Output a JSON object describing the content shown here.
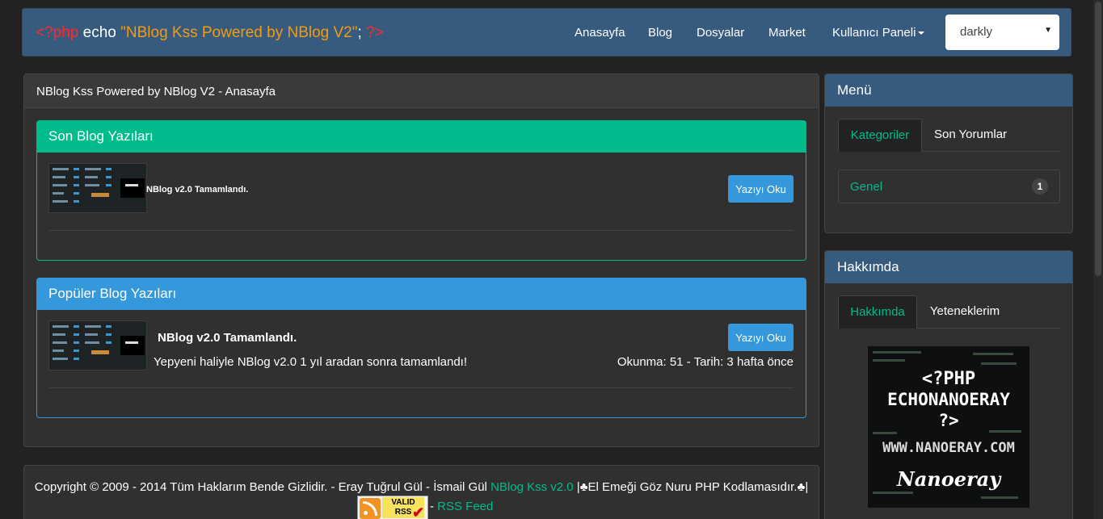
{
  "navbar": {
    "brand": {
      "open_tag": "<?php",
      "echo": " echo ",
      "string": "\"NBlog Kss Powered by NBlog V2\"",
      "semicolon": "; ",
      "close_tag": "?>"
    },
    "links": [
      "Anasayfa",
      "Blog",
      "Dosyalar",
      "Market",
      "Kullanıcı Paneli"
    ],
    "theme_select": "darkly"
  },
  "main": {
    "heading": "NBlog Kss Powered by NBlog V2 - Anasayfa",
    "recent": {
      "heading": "Son Blog Yazıları",
      "post_title": "NBlog v2.0 Tamamlandı.",
      "button": "Yazıyı Oku"
    },
    "popular": {
      "heading": "Popüler Blog Yazıları",
      "post_title": "NBlog v2.0 Tamamlandı.",
      "description": "Yepyeni haliyle NBlog v2.0 1 yıl aradan sonra tamamlandı!",
      "meta": "Okunma: 51 - Tarih: 3 hafta önce",
      "button": "Yazıyı Oku"
    }
  },
  "footer": {
    "copyright": "Copyright © 2009 - 2014 Tüm Haklarım Bende Gizlidir. - Eray Tuğrul Gül - İsmail Gül ",
    "brand_link": "NBlog Kss v2.0",
    "tagline": " |♣El Emeği Göz Nuru PHP Kodlamasıdır.♣|",
    "rss_badge_line1": "VALID",
    "rss_badge_line2": "RSS",
    "rss_sep": " - ",
    "rss_link": "RSS Feed"
  },
  "sidebar": {
    "menu": {
      "heading": "Menü",
      "tabs": [
        "Kategoriler",
        "Son Yorumlar"
      ],
      "categories": [
        {
          "name": "Genel",
          "count": "1"
        }
      ]
    },
    "about": {
      "heading": "Hakkımda",
      "tabs": [
        "Hakkımda",
        "Yeteneklerim"
      ],
      "image_text": {
        "line1": "<?PHP",
        "line2": "ECHONANOERAY",
        "line3": "?>",
        "url": "WWW.NANOERAY.COM",
        "signature": "Nanoeray"
      }
    }
  },
  "colors": {
    "primary": "#375a7f",
    "success": "#00bc8c",
    "info": "#3498db",
    "warning": "#f39c12",
    "danger": "#ff2a2a"
  }
}
